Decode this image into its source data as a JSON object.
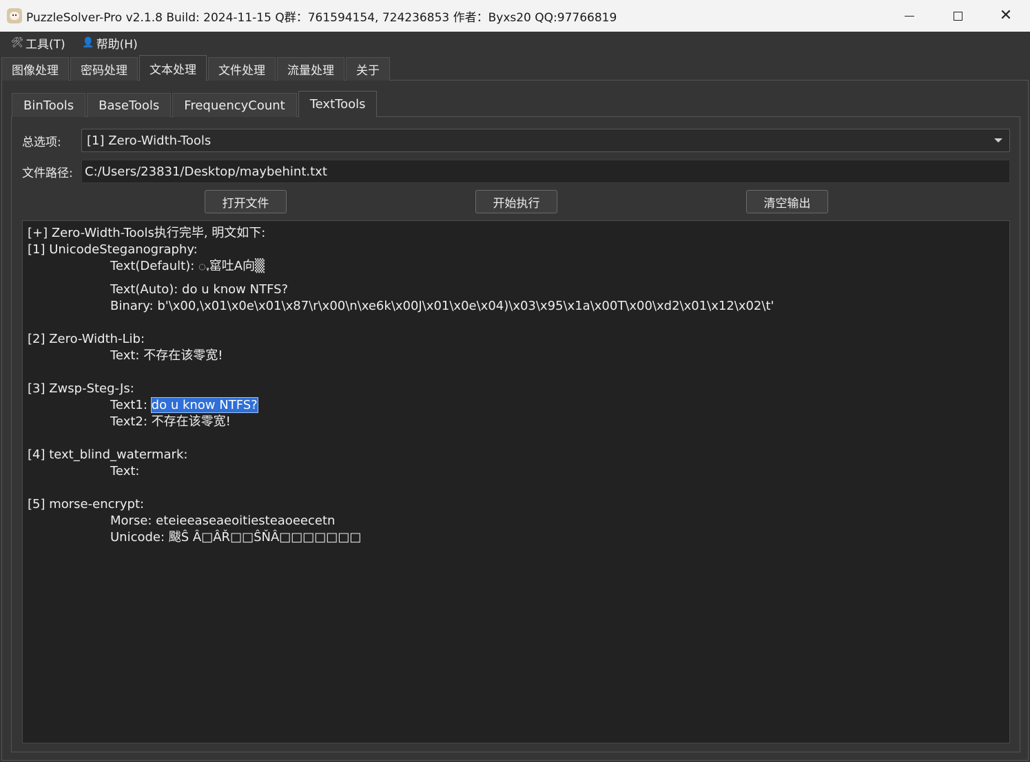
{
  "window": {
    "title": "PuzzleSolver-Pro v2.1.8  Build: 2024-11-15  Q群：761594154, 724236853  作者：Byxs20  QQ:97766819"
  },
  "menu": {
    "tools": "工具(T)",
    "help": "帮助(H)"
  },
  "top_tabs": [
    "图像处理",
    "密码处理",
    "文本处理",
    "文件处理",
    "流量处理",
    "关于"
  ],
  "sub_tabs": [
    "BinTools",
    "BaseTools",
    "FrequencyCount",
    "TextTools"
  ],
  "form": {
    "option_label": "总选项:",
    "option_value": "[1] Zero-Width-Tools",
    "path_label": "文件路径:",
    "path_value": "C:/Users/23831/Desktop/maybehint.txt"
  },
  "buttons": {
    "open": "打开文件",
    "run": "开始执行",
    "clear": "清空输出"
  },
  "output": {
    "header": "[+] Zero-Width-Tools执行完毕, 明文如下:",
    "s1_title": "[1] UnicodeSteganography:",
    "s1_text_default": "Text(Default): ꩻ窰吐A向▒",
    "s1_text_auto": "Text(Auto): do u know NTFS?",
    "s1_binary": "Binary: b'\\x00,\\x01\\x0e\\x01\\x87\\r\\x00\\n\\xe6k\\x00J\\x01\\x0e\\x04)\\x03\\x95\\x1a\\x00T\\x00\\xd2\\x01\\x12\\x02\\t'",
    "s2_title": "[2] Zero-Width-Lib:",
    "s2_text": "Text: 不存在该零宽!",
    "s3_title": "[3] Zwsp-Steg-Js:",
    "s3_text1_label": "Text1: ",
    "s3_text1_value": "do u know NTFS?",
    "s3_text2": "Text2: 不存在该零宽!",
    "s4_title": "[4] text_blind_watermark:",
    "s4_text": "Text:",
    "s5_title": "[5] morse-encrypt:",
    "s5_morse": "Morse: eteieeaseaeoitiesteaoeecetn",
    "s5_unicode": "Unicode: 颰Ŝ Â□ÂŘ□□ŜŇÂ□□□□□□□"
  }
}
